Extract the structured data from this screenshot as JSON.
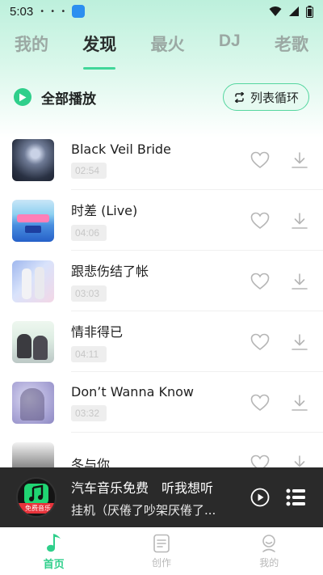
{
  "status_bar": {
    "time": "5:03",
    "dots": "• • •",
    "icons": [
      "app-icon",
      "wifi-icon",
      "signal-icon",
      "battery-icon"
    ]
  },
  "tabs": [
    {
      "label": "我的",
      "active": false
    },
    {
      "label": "发现",
      "active": true
    },
    {
      "label": "最火",
      "active": false
    },
    {
      "label": "DJ",
      "active": false
    },
    {
      "label": "老歌",
      "active": false
    }
  ],
  "play_all": {
    "label": "全部播放",
    "icon": "play-circle-icon"
  },
  "loop_mode": {
    "label": "列表循环",
    "icon": "loop-icon"
  },
  "songs": [
    {
      "title": "Black Veil Bride",
      "duration": "02:54"
    },
    {
      "title": "时差 (Live)",
      "duration": "04:06"
    },
    {
      "title": "跟悲伤结了帐",
      "duration": "03:03"
    },
    {
      "title": "情非得已",
      "duration": "04:11"
    },
    {
      "title": "Don’t Wanna Know",
      "duration": "03:32"
    },
    {
      "title": "冬与你",
      "duration": ""
    }
  ],
  "mini_player": {
    "title": "汽车音乐免费　听我想听",
    "subtitle": "挂机（厌倦了吵架厌倦了...",
    "cover_badge": "免费音乐",
    "icons": [
      "play-icon",
      "playlist-icon"
    ]
  },
  "bottom_nav": [
    {
      "label": "首页",
      "icon": "music-note-icon",
      "active": true
    },
    {
      "label": "创作",
      "icon": "document-icon",
      "active": false
    },
    {
      "label": "我的",
      "icon": "profile-icon",
      "active": false
    }
  ],
  "colors": {
    "accent": "#2fcf8b",
    "mini_player_bg": "#2a2a2a",
    "duration_bg": "#eeeeee"
  }
}
